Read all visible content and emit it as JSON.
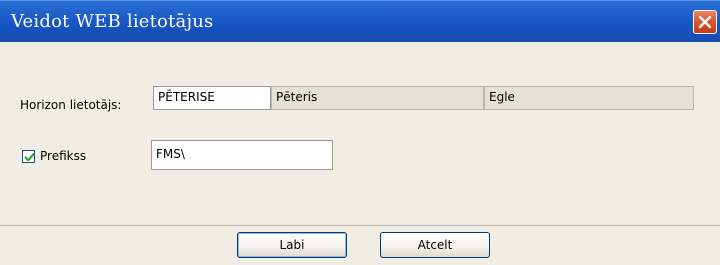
{
  "window": {
    "title": "Veidot WEB lietotājus",
    "close_icon": "close-icon"
  },
  "form": {
    "horizon_user_label": "Horizon lietotājs:",
    "horizon_user_id": "PĒTERISE",
    "first_name": "Pēteris",
    "last_name": "Egle",
    "prefix_label": "Prefikss",
    "prefix_checked": true,
    "prefix_value": "FMS\\"
  },
  "buttons": {
    "ok_label": "Labi",
    "cancel_label": "Atcelt"
  },
  "colors": {
    "titlebar": "#1c5cc8",
    "close_button": "#d8552e",
    "window_bg": "#f0ede4",
    "readonly_field": "#e4e2d8"
  }
}
